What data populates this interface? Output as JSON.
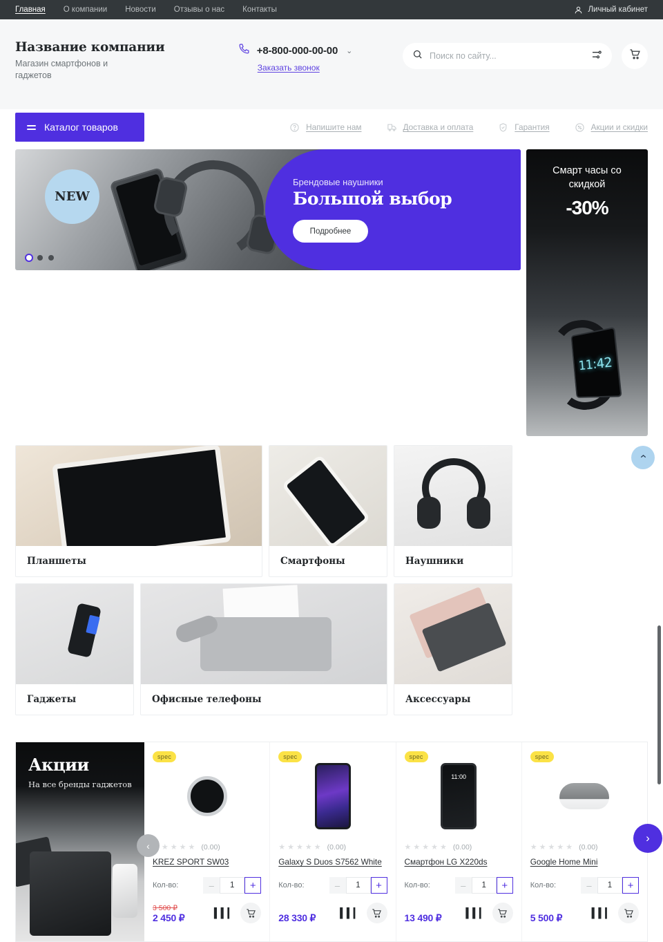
{
  "topnav": {
    "items": [
      {
        "label": "Главная",
        "active": true
      },
      {
        "label": "О компании",
        "active": false
      },
      {
        "label": "Новости",
        "active": false
      },
      {
        "label": "Отзывы о нас",
        "active": false
      },
      {
        "label": "Контакты",
        "active": false
      }
    ],
    "account_label": "Личный кабинет"
  },
  "header": {
    "brand_title": "Название компании",
    "brand_subtitle": "Магазин смартфонов и гаджетов",
    "phone": "+8-800-000-00-00",
    "callback_label": "Заказать звонок",
    "search_placeholder": "Поиск по сайту...",
    "search_value": ""
  },
  "navstrip": {
    "catalog_label": "Каталог товаров",
    "links": [
      {
        "label": "Напишите нам",
        "icon": "question-icon"
      },
      {
        "label": "Доставка и оплата",
        "icon": "delivery-icon"
      },
      {
        "label": "Гарантия",
        "icon": "shield-icon"
      },
      {
        "label": "Акции и скидки",
        "icon": "discount-icon"
      }
    ]
  },
  "hero": {
    "badge": "NEW",
    "kicker": "Брендовые наушники",
    "title": "Большой выбор",
    "button": "Подробнее",
    "slides": 3,
    "active_slide": 1
  },
  "sidebanner": {
    "title": "Смарт часы со скидкой",
    "discount": "-30%",
    "watch_time": "11:42"
  },
  "categories": [
    {
      "label": "Планшеты",
      "art": "tablet"
    },
    {
      "label": "Смартфоны",
      "art": "sphone"
    },
    {
      "label": "Наушники",
      "art": "hp"
    },
    {
      "label": "Гаджеты",
      "art": "gadget"
    },
    {
      "label": "Офисные телефоны",
      "art": "fax"
    },
    {
      "label": "Аксессуары",
      "art": "acc"
    }
  ],
  "promo": {
    "title": "Акции",
    "subtitle": "На все бренды гаджетов"
  },
  "products": {
    "qty_label": "Кол-во:",
    "rating_text": "(0.00)",
    "currency": "₽",
    "items": [
      {
        "badge": "spec",
        "name": "KREZ SPORT SW03",
        "qty": "1",
        "old_price": "3 500 ₽",
        "price": "2 450 ₽",
        "art": "watch"
      },
      {
        "badge": "spec",
        "name": "Galaxy S Duos S7562 White",
        "qty": "1",
        "old_price": "",
        "price": "28 330 ₽",
        "art": "galaxy"
      },
      {
        "badge": "spec",
        "name": "Смартфон LG X220ds",
        "qty": "1",
        "old_price": "",
        "price": "13 490 ₽",
        "art": "lg",
        "screen_time": "11:00"
      },
      {
        "badge": "spec",
        "name": "Google Home Mini",
        "qty": "1",
        "old_price": "",
        "price": "5 500 ₽",
        "art": "home"
      }
    ]
  },
  "controls": {
    "prev": "‹",
    "next": "›",
    "scroll_top": "⌃",
    "minus": "–",
    "plus": "+"
  },
  "colors": {
    "accent": "#4f2fe0",
    "topbar": "#33383b",
    "badge_yellow": "#fbe246",
    "old_price_red": "#e04a4a",
    "scrolltop_blue": "#aed4ef"
  }
}
